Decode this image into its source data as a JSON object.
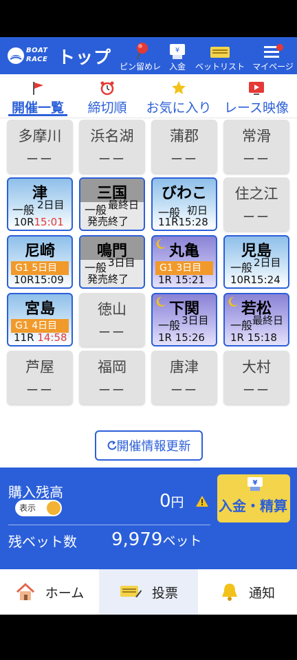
{
  "header": {
    "logo_text": [
      "BOAT",
      "RACE"
    ],
    "title": "トップ",
    "pin_label": "ピン留めレース",
    "deposit_label": "入金",
    "betlist_label": "ベットリスト",
    "mypage_label": "マイページ"
  },
  "tabs": [
    {
      "label": "開催一覧",
      "icon": "flag-icon",
      "active": true
    },
    {
      "label": "締切順",
      "icon": "alarm-clock-icon"
    },
    {
      "label": "お気に入り",
      "icon": "star-icon"
    },
    {
      "label": "レース映像",
      "icon": "play-video-icon"
    }
  ],
  "venues_off_dash": "ーー",
  "venues": {
    "tamagawa": "多摩川",
    "hamanako": "浜名湖",
    "gamagori": "蒲郡",
    "tokoname": "常滑",
    "tsu": "津",
    "mikuni": "三国",
    "biwako": "びわこ",
    "suminoe": "住之江",
    "amagasaki": "尼崎",
    "naruto": "鳴門",
    "marugame": "丸亀",
    "kojima": "児島",
    "miyajima": "宮島",
    "tokuyama": "徳山",
    "shimonoseki": "下関",
    "wakamatsu": "若松",
    "ashiya": "芦屋",
    "fukuoka": "福岡",
    "karatsu": "唐津",
    "omura": "大村"
  },
  "race_cards": {
    "tsu": {
      "kind": "一般",
      "day": "2日目",
      "race": "10R",
      "time": "15:01"
    },
    "mikuni": {
      "kind": "一般",
      "day": "最終日",
      "note": "発売終了"
    },
    "biwako": {
      "kind": "一般",
      "day": "初日",
      "race": "11R",
      "time": "15:28"
    },
    "amagasaki": {
      "grade": "G1",
      "day": "5日目",
      "race": "10R",
      "time": "15:09"
    },
    "naruto": {
      "kind": "一般",
      "day": "3日目",
      "note": "発売終了"
    },
    "marugame": {
      "grade": "G1",
      "day": "3日目",
      "race": "1R",
      "time": "15:21"
    },
    "kojima": {
      "kind": "一般",
      "day": "2日目",
      "race": "10R",
      "time": "15:24"
    },
    "miyajima": {
      "grade": "G1",
      "day": "4日目",
      "race": "11R",
      "time": "14:58"
    },
    "shimonoseki": {
      "kind": "一般",
      "day": "3日目",
      "race": "1R",
      "time": "15:26"
    },
    "wakamatsu": {
      "kind": "一般",
      "day": "最終日",
      "race": "1R",
      "time": "15:18"
    }
  },
  "refresh_label": "開催情報更新",
  "balance": {
    "label": "購入残高",
    "toggle_label": "表示",
    "amount": "0",
    "unit": "円",
    "deposit_button": "入金・精算",
    "bets_label": "残ベット数",
    "bets_value": "9,979",
    "bets_unit": "ベット"
  },
  "bottom_nav": {
    "home": "ホーム",
    "vote": "投票",
    "notice": "通知"
  },
  "colors": {
    "primary": "#2b5fd9",
    "accent": "#f3d44a",
    "grade": "#f19a2b",
    "deadline": "#e53935"
  }
}
